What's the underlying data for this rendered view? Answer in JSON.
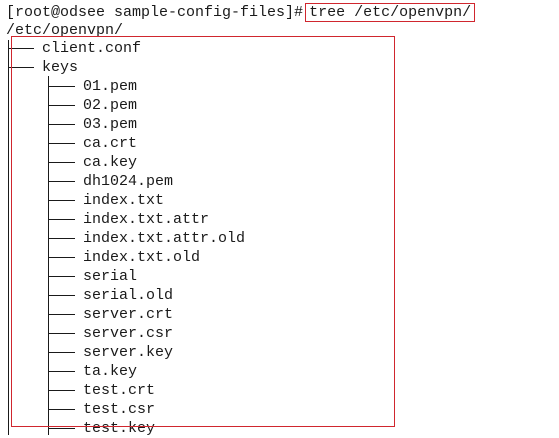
{
  "terminal": {
    "prompt": "[root@odsee sample-config-files]#",
    "command": "tree /etc/openvpn/",
    "root": "/etc/openvpn/",
    "top_entries": [
      "client.conf",
      "keys"
    ],
    "keys_entries": [
      "01.pem",
      "02.pem",
      "03.pem",
      "ca.crt",
      "ca.key",
      "dh1024.pem",
      "index.txt",
      "index.txt.attr",
      "index.txt.attr.old",
      "index.txt.old",
      "serial",
      "serial.old",
      "server.crt",
      "server.csr",
      "server.key",
      "ta.key",
      "test.crt",
      "test.csr",
      "test.key"
    ]
  },
  "colors": {
    "highlight": "#d0262e",
    "text": "#1a1a1a",
    "background": "#ffffff"
  }
}
